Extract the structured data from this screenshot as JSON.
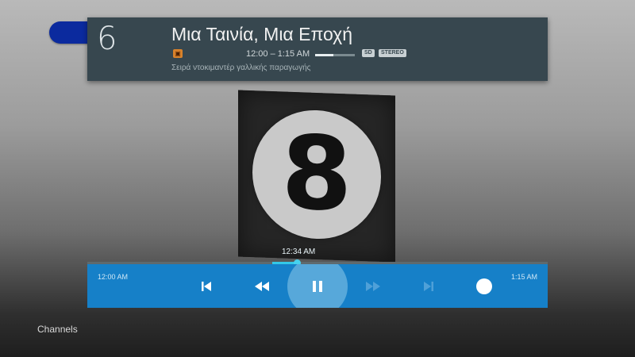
{
  "info_card": {
    "channel_number": "6",
    "title": "Μια Ταινία, Μια Εποχή",
    "time_range": "12:00 – 1:15 AM",
    "progress_fraction": 0.45,
    "badges": {
      "sd": "SD",
      "stereo": "STEREO"
    },
    "description": "Σειρά ντοκιμαντέρ γαλλικής παραγωγής"
  },
  "player": {
    "current_time": "12:34 AM",
    "start_time": "12:00 AM",
    "end_time": "1:15 AM",
    "controls": {
      "skip_previous": "skip-previous-icon",
      "rewind": "rewind-icon",
      "pause": "pause-icon",
      "fast_forward": "fast-forward-icon",
      "skip_next": "skip-next-icon",
      "record": "record-icon"
    }
  },
  "footer": {
    "channels_label": "Channels"
  },
  "colors": {
    "accent": "#1680c8",
    "seek": "#33c8e8",
    "card": "#37474f"
  }
}
